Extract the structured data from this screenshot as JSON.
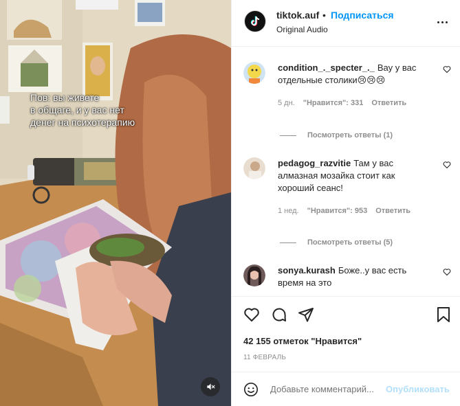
{
  "video": {
    "caption": "Пов: вы живете\nв общаге, и у вас нет\nденег на психотерапию"
  },
  "header": {
    "username": "tiktok.auf",
    "separator": "•",
    "follow_label": "Подписаться",
    "audio": "Original Audio",
    "avatar_icon": "tiktok-logo-icon",
    "more_icon": "more-options-icon"
  },
  "comments": [
    {
      "username": "condition_._specter_._",
      "text": "Вау у вас отдельные столики😢😢😢",
      "time": "5 дн.",
      "likes": "\"Нравится\": 331",
      "reply": "Ответить",
      "view_replies": "Посмотреть ответы (1)",
      "avatar_color": "#f2d84a"
    },
    {
      "username": "pedagog_razvitie",
      "text": "Там у вас алмазная мозайка стоит как хороший сеанс!",
      "time": "1 нед.",
      "likes": "\"Нравится\": 953",
      "reply": "Ответить",
      "view_replies": "Посмотреть ответы (5)",
      "avatar_color": "#d9c8b4"
    },
    {
      "username": "sonya.kurash",
      "text": "Боже..у вас есть время на это",
      "avatar_color": "#3b2a2a"
    }
  ],
  "actions": {
    "like_icon": "heart-icon",
    "comment_icon": "comment-icon",
    "share_icon": "share-icon",
    "save_icon": "bookmark-icon",
    "likes_count": "42 155 отметок \"Нравится\"",
    "date": "11 ФЕВРАЛЬ"
  },
  "add_comment": {
    "emoji_icon": "emoji-icon",
    "placeholder": "Добавьте комментарий...",
    "publish_label": "Опубликовать"
  },
  "colors": {
    "accent": "#0095f6",
    "publish_disabled": "#b2dffc",
    "muted_text": "#8e8e8e"
  }
}
